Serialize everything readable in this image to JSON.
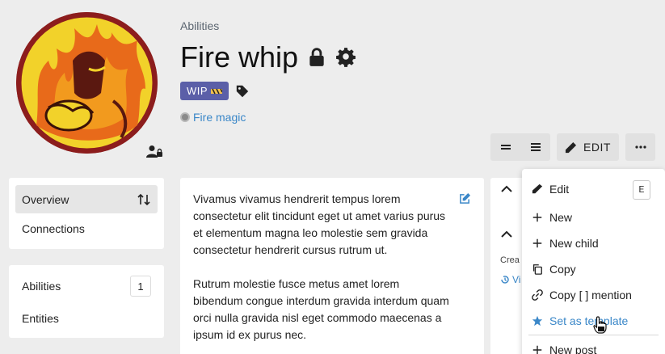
{
  "breadcrumb": "Abilities",
  "title": "Fire whip",
  "wip_label": "WIP",
  "category": "Fire magic",
  "toolbar": {
    "edit_label": "EDIT"
  },
  "nav": {
    "items": [
      {
        "label": "Overview"
      },
      {
        "label": "Connections"
      }
    ]
  },
  "lists": {
    "items": [
      {
        "label": "Abilities",
        "count": "1"
      },
      {
        "label": "Entities"
      }
    ]
  },
  "entry": {
    "paragraphs": [
      "Vivamus vivamus hendrerit tempus lorem consectetur elit tincidunt eget ut amet varius purus et elementum magna leo molestie sem gravida consectetur hendrerit cursus rutrum ut.",
      "Rutrum molestie fusce metus amet lorem bibendum congue interdum gravida interdum quam orci nulla gravida nisl eget commodo maecenas a ipsum id ex purus nec."
    ]
  },
  "side": {
    "created_prefix": "Crea",
    "view_prefix": "Vi"
  },
  "menu": {
    "items": [
      {
        "label": "Edit",
        "shortcut": "E"
      },
      {
        "label": "New"
      },
      {
        "label": "New child"
      },
      {
        "label": "Copy"
      },
      {
        "label": "Copy [ ] mention"
      },
      {
        "label": "Set as template"
      },
      {
        "label": "New post"
      }
    ]
  },
  "colors": {
    "accent": "#3a87c8",
    "wip": "#5b5fa8"
  }
}
